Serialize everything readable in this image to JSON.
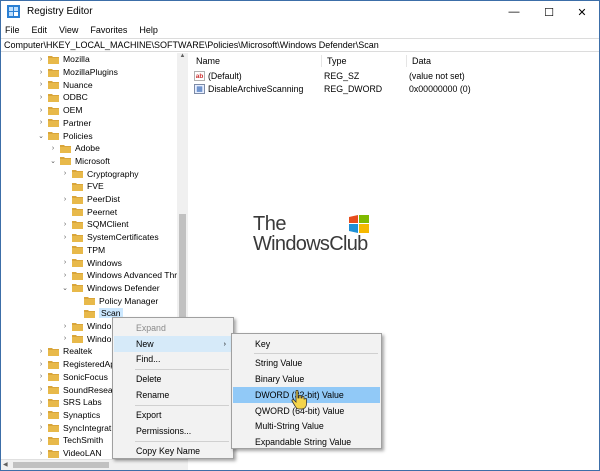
{
  "window": {
    "title": "Registry Editor",
    "controls": {
      "minimize": "—",
      "maximize": "☐",
      "close": "✕"
    }
  },
  "menubar": [
    "File",
    "Edit",
    "View",
    "Favorites",
    "Help"
  ],
  "address": "Computer\\HKEY_LOCAL_MACHINE\\SOFTWARE\\Policies\\Microsoft\\Windows Defender\\Scan",
  "tree": [
    {
      "label": "Mozilla",
      "indent": 0,
      "arrow": "›"
    },
    {
      "label": "MozillaPlugins",
      "indent": 0,
      "arrow": "›"
    },
    {
      "label": "Nuance",
      "indent": 0,
      "arrow": "›"
    },
    {
      "label": "ODBC",
      "indent": 0,
      "arrow": "›"
    },
    {
      "label": "OEM",
      "indent": 0,
      "arrow": "›"
    },
    {
      "label": "Partner",
      "indent": 0,
      "arrow": "›"
    },
    {
      "label": "Policies",
      "indent": 0,
      "arrow": "⌄"
    },
    {
      "label": "Adobe",
      "indent": 1,
      "arrow": "›"
    },
    {
      "label": "Microsoft",
      "indent": 1,
      "arrow": "⌄"
    },
    {
      "label": "Cryptography",
      "indent": 2,
      "arrow": "›"
    },
    {
      "label": "FVE",
      "indent": 2,
      "arrow": ""
    },
    {
      "label": "PeerDist",
      "indent": 2,
      "arrow": "›"
    },
    {
      "label": "Peernet",
      "indent": 2,
      "arrow": ""
    },
    {
      "label": "SQMClient",
      "indent": 2,
      "arrow": "›"
    },
    {
      "label": "SystemCertificates",
      "indent": 2,
      "arrow": "›"
    },
    {
      "label": "TPM",
      "indent": 2,
      "arrow": ""
    },
    {
      "label": "Windows",
      "indent": 2,
      "arrow": "›"
    },
    {
      "label": "Windows Advanced Thr",
      "indent": 2,
      "arrow": "›"
    },
    {
      "label": "Windows Defender",
      "indent": 2,
      "arrow": "⌄"
    },
    {
      "label": "Policy Manager",
      "indent": 3,
      "arrow": ""
    },
    {
      "label": "Scan",
      "indent": 3,
      "arrow": "",
      "selected": true
    },
    {
      "label": "Windo",
      "indent": 2,
      "arrow": "›"
    },
    {
      "label": "Windo",
      "indent": 2,
      "arrow": "›"
    },
    {
      "label": "Realtek",
      "indent": 0,
      "arrow": "›"
    },
    {
      "label": "RegisteredAp",
      "indent": 0,
      "arrow": "›"
    },
    {
      "label": "SonicFocus",
      "indent": 0,
      "arrow": "›"
    },
    {
      "label": "SoundResea",
      "indent": 0,
      "arrow": "›"
    },
    {
      "label": "SRS Labs",
      "indent": 0,
      "arrow": "›"
    },
    {
      "label": "Synaptics",
      "indent": 0,
      "arrow": "›"
    },
    {
      "label": "SyncIntegrat",
      "indent": 0,
      "arrow": "›"
    },
    {
      "label": "TechSmith",
      "indent": 0,
      "arrow": "›"
    },
    {
      "label": "VideoLAN",
      "indent": 0,
      "arrow": "›"
    }
  ],
  "columns": {
    "name": "Name",
    "type": "Type",
    "data": "Data"
  },
  "values": [
    {
      "name": "(Default)",
      "type": "REG_SZ",
      "data": "(value not set)",
      "icon": "ab"
    },
    {
      "name": "DisableArchiveScanning",
      "type": "REG_DWORD",
      "data": "0x00000000 (0)",
      "icon": "dword"
    }
  ],
  "watermark": {
    "line1": "The",
    "line2": "WindowsClub"
  },
  "context_menu": [
    {
      "label": "Expand",
      "disabled": true
    },
    {
      "label": "New",
      "submenu": "›",
      "highlighted": true
    },
    {
      "label": "Find..."
    },
    {
      "label": "Delete"
    },
    {
      "label": "Rename"
    },
    {
      "label": "Export"
    },
    {
      "label": "Permissions..."
    },
    {
      "label": "Copy Key Name"
    }
  ],
  "new_submenu": [
    {
      "label": "Key"
    },
    {
      "label": "String Value"
    },
    {
      "label": "Binary Value"
    },
    {
      "label": "DWORD (32-bit) Value",
      "highlighted": true
    },
    {
      "label": "QWORD (64-bit) Value"
    },
    {
      "label": "Multi-String Value"
    },
    {
      "label": "Expandable String Value"
    }
  ],
  "colors": {
    "folder": "#e8b94a",
    "folder_dark": "#d9a53a",
    "selection": "#cce8ff",
    "menu_highlight": "#91c9f7",
    "logo_red": "#e74c1c",
    "logo_green": "#7fba00",
    "logo_blue": "#1e90d6",
    "logo_yellow": "#f5b800"
  }
}
